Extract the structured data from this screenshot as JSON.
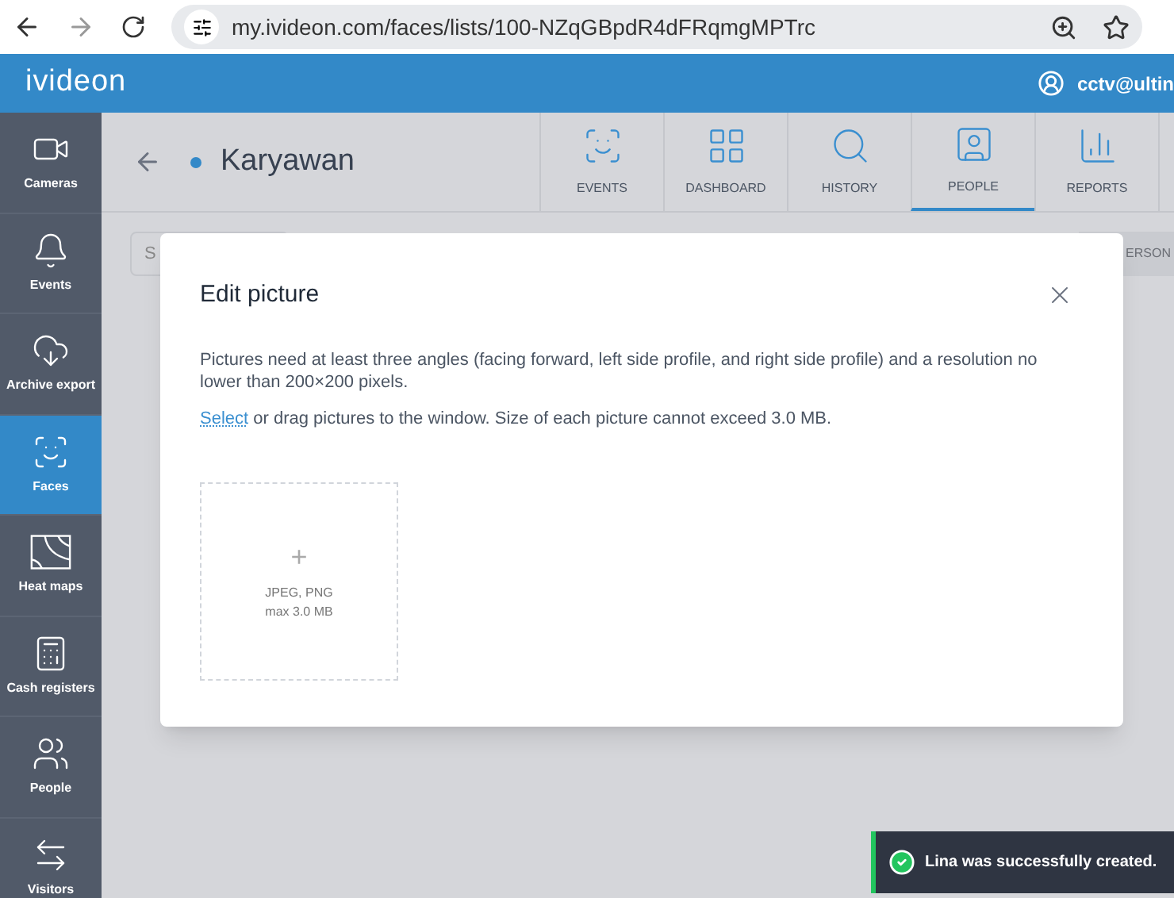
{
  "browser": {
    "url": "my.ivideon.com/faces/lists/100-NZqGBpdR4dFRqmgMPTrc"
  },
  "header": {
    "logo": "ivideon",
    "user": "cctv@ultin"
  },
  "sidebar": {
    "items": [
      {
        "label": "Cameras",
        "kind": "camera",
        "selected": false
      },
      {
        "label": "Events",
        "kind": "bell",
        "selected": false
      },
      {
        "label": "Archive export",
        "kind": "cloud",
        "selected": false
      },
      {
        "label": "Faces",
        "kind": "face",
        "selected": true
      },
      {
        "label": "Heat maps",
        "kind": "heat",
        "selected": false
      },
      {
        "label": "Cash registers",
        "kind": "register",
        "selected": false
      },
      {
        "label": "People",
        "kind": "people",
        "selected": false
      },
      {
        "label": "Visitors",
        "kind": "visitors",
        "selected": false
      }
    ]
  },
  "page": {
    "title": "Karyawan",
    "search_placeholder": "S",
    "add_button": "ERSON"
  },
  "tabs": [
    {
      "label": "EVENTS",
      "kind": "face",
      "selected": false
    },
    {
      "label": "DASHBOARD",
      "kind": "grid",
      "selected": false
    },
    {
      "label": "HISTORY",
      "kind": "search",
      "selected": false
    },
    {
      "label": "PEOPLE",
      "kind": "person",
      "selected": true
    },
    {
      "label": "REPORTS",
      "kind": "chart",
      "selected": false
    }
  ],
  "dialog": {
    "title": "Edit picture",
    "note": "Pictures need at least three angles (facing forward, left side profile, and right side profile) and a resolution no lower than 200×200 pixels.",
    "select_link": "Select",
    "select_text": "or drag pictures to the window. Size of each picture cannot exceed 3.0 MB.",
    "upload": {
      "plus": "+",
      "formats": "JPEG, PNG",
      "max": "max 3.0 MB"
    }
  },
  "toast": {
    "message": "Lina was successfully created."
  }
}
